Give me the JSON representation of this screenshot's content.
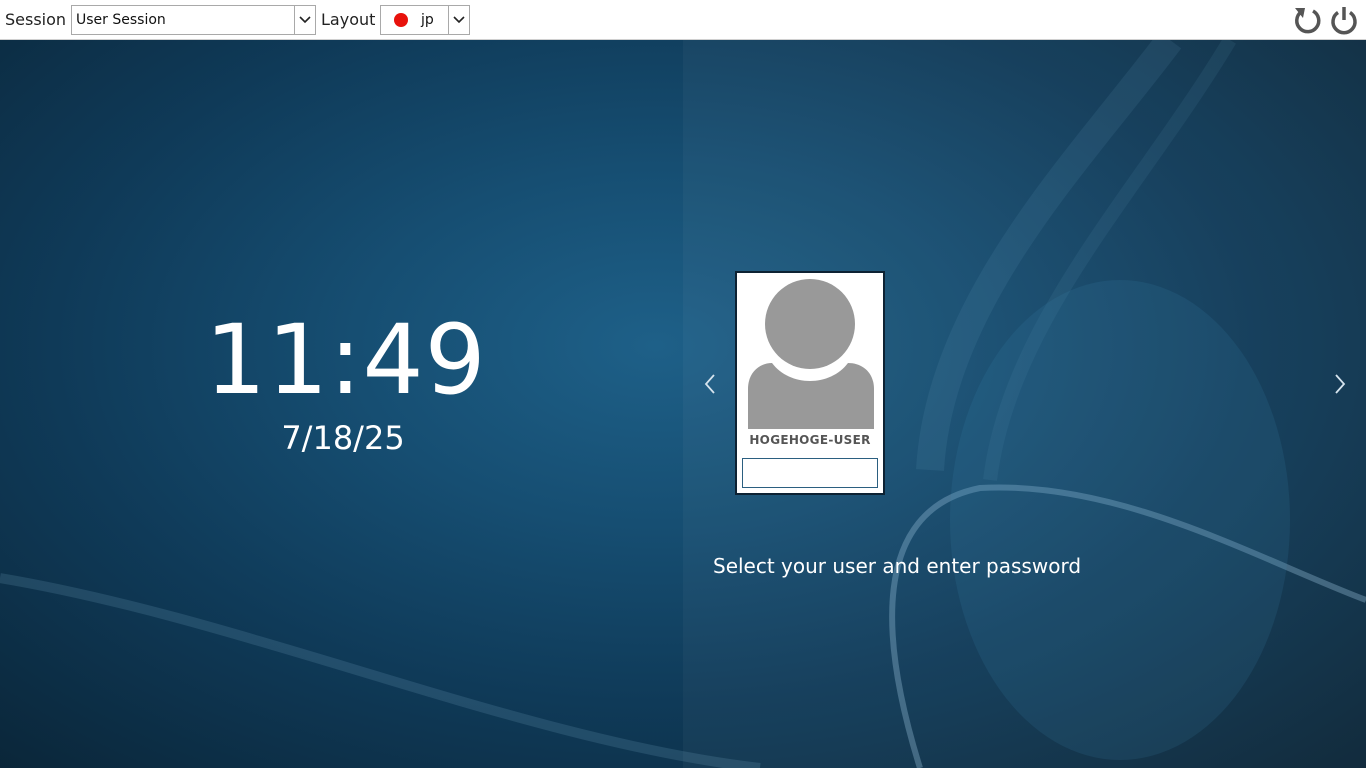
{
  "topbar": {
    "session_label": "Session",
    "session_value": "User Session",
    "layout_label": "Layout",
    "layout_value": "jp",
    "icons": {
      "reboot": "reboot-icon",
      "shutdown": "power-icon"
    }
  },
  "greeter": {
    "time": "11:49",
    "date": "7/18/25",
    "user": {
      "name": "HOGEHOGE-USER",
      "password_value": ""
    },
    "prompt": "Select your user and enter password"
  },
  "colors": {
    "background_dark": "#0a2436",
    "background_mid": "#164e72",
    "background_light": "#1e6088",
    "layout_indicator": "#e8120c",
    "avatar_gray": "#999999",
    "card_border": "#0d2233"
  }
}
